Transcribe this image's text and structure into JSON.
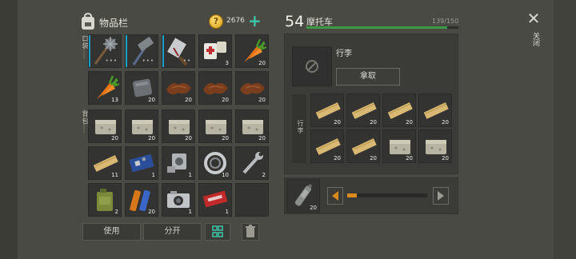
{
  "inventory": {
    "title": "物品栏",
    "coins": "2676",
    "quick_label": "口袋",
    "backpack_label": "背包",
    "quick_slots": [
      {
        "icon": "spiked-mace-icon",
        "count": "",
        "dots": "•••",
        "durability": true
      },
      {
        "icon": "sledgehammer-icon",
        "count": "",
        "dots": "•••",
        "durability": true
      },
      {
        "icon": "cleaver-icon",
        "count": "",
        "dots": "••",
        "durability": true
      },
      {
        "icon": "first-aid-kit-icon",
        "count": "3",
        "dots": "",
        "durability": false
      },
      {
        "icon": "carrot-icon",
        "count": "20",
        "dots": "",
        "durability": false
      },
      {
        "icon": "carrot-icon",
        "count": "13",
        "dots": "",
        "durability": false
      },
      {
        "icon": "metal-plate-icon",
        "count": "20",
        "dots": "",
        "durability": false
      },
      {
        "icon": "leather-icon",
        "count": "20",
        "dots": "",
        "durability": false
      },
      {
        "icon": "leather-icon",
        "count": "20",
        "dots": "",
        "durability": false
      },
      {
        "icon": "leather-icon",
        "count": "20",
        "dots": "",
        "durability": false
      }
    ],
    "backpack_slots": [
      {
        "icon": "stone-block-icon",
        "count": "20"
      },
      {
        "icon": "stone-block-icon",
        "count": "20"
      },
      {
        "icon": "stone-block-icon",
        "count": "20"
      },
      {
        "icon": "stone-block-icon",
        "count": "20"
      },
      {
        "icon": "stone-block-icon",
        "count": "20"
      },
      {
        "icon": "wood-plank-icon",
        "count": "11"
      },
      {
        "icon": "circuit-board-icon",
        "count": "1"
      },
      {
        "icon": "engine-part-icon",
        "count": "1"
      },
      {
        "icon": "bearing-ring-icon",
        "count": "10"
      },
      {
        "icon": "wrench-icon",
        "count": "2"
      },
      {
        "icon": "jerry-can-icon",
        "count": "2"
      },
      {
        "icon": "battery-icon",
        "count": "20"
      },
      {
        "icon": "camera-icon",
        "count": "1"
      },
      {
        "icon": "ticket-icon",
        "count": "1"
      },
      {
        "icon": "empty",
        "count": ""
      }
    ],
    "use_label": "使用",
    "split_label": "分开"
  },
  "vehicle": {
    "level": "54",
    "name": "摩托车",
    "hp_text": "139/150",
    "hp_fraction": 0.927,
    "luggage_title": "行李",
    "take_label": "拿取",
    "luggage_label": "行李",
    "luggage_slots": [
      {
        "icon": "wood-plank-icon",
        "count": "20"
      },
      {
        "icon": "wood-plank-icon",
        "count": "20"
      },
      {
        "icon": "wood-plank-icon",
        "count": "20"
      },
      {
        "icon": "wood-plank-icon",
        "count": "20"
      },
      {
        "icon": "wood-plank-icon",
        "count": "20"
      },
      {
        "icon": "wood-plank-icon",
        "count": "20"
      },
      {
        "icon": "stone-block-icon",
        "count": "20"
      },
      {
        "icon": "stone-block-icon",
        "count": "20"
      }
    ],
    "fuel_count": "20",
    "fuel_fraction": 0.12
  },
  "close_label": "关闭",
  "colors": {
    "accent": "#3fc6a8",
    "durability": "#1aa0c8",
    "hp": "#3c9a44",
    "fuel": "#d88a1c"
  }
}
